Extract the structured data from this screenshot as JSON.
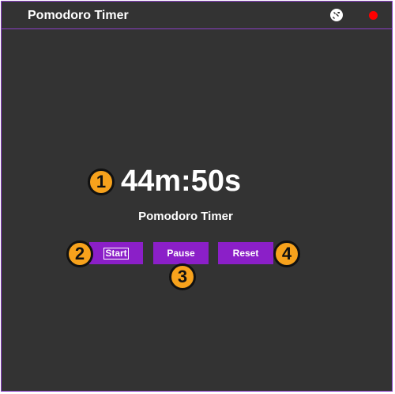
{
  "window": {
    "title": "Pomodoro Timer",
    "settings_icon": "settings-wrench-icon",
    "close_icon": "close-dot-icon",
    "colors": {
      "background": "#333333",
      "border": "#8b3fc6",
      "button": "#8b1fc8",
      "close": "#ff0000",
      "marker": "#f7a21c"
    }
  },
  "main": {
    "timer": "44m:50s",
    "subtitle": "Pomodoro Timer",
    "buttons": {
      "start": "Start",
      "pause": "Pause",
      "reset": "Reset"
    }
  },
  "markers": [
    "1",
    "2",
    "3",
    "4"
  ]
}
